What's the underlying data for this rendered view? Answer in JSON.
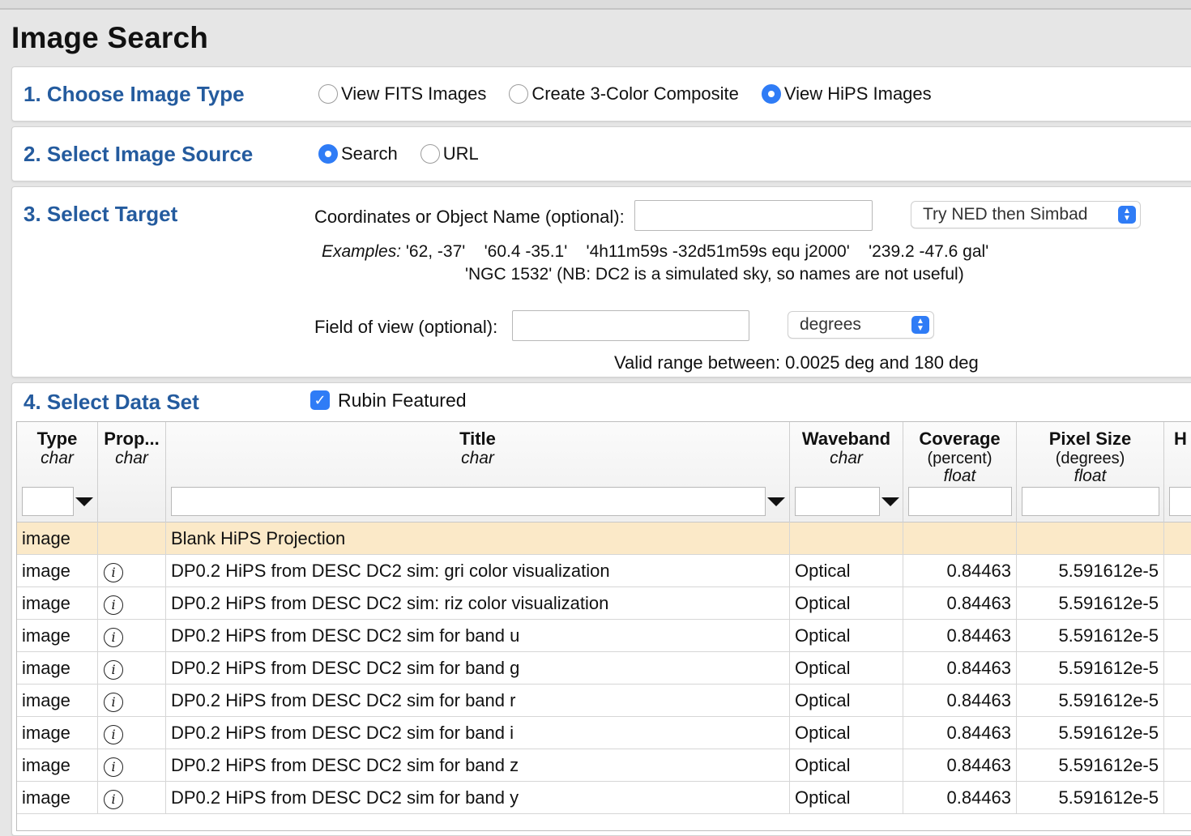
{
  "page": {
    "title": "Image Search"
  },
  "section1": {
    "title": "1. Choose Image Type",
    "options": [
      {
        "label": "View FITS Images",
        "selected": false
      },
      {
        "label": "Create 3-Color Composite",
        "selected": false
      },
      {
        "label": "View HiPS Images",
        "selected": true
      }
    ]
  },
  "section2": {
    "title": "2. Select Image Source",
    "options": [
      {
        "label": "Search",
        "selected": true
      },
      {
        "label": "URL",
        "selected": false
      }
    ]
  },
  "section3": {
    "title": "3. Select Target",
    "coords_label": "Coordinates or Object Name (optional):",
    "coords_value": "",
    "resolver_selected": "Try NED then Simbad",
    "examples_label": "Examples:",
    "examples_line1": "'62, -37'    '60.4 -35.1'    '4h11m59s -32d51m59s equ j2000'    '239.2 -47.6 gal'",
    "examples_line2": "'NGC 1532' (NB: DC2 is a simulated sky, so names are not useful)",
    "fov_label": "Field of view (optional):",
    "fov_value": "",
    "fov_unit_selected": "degrees",
    "valid_range": "Valid range between: 0.0025 deg and 180 deg"
  },
  "section4": {
    "title": "4. Select Data Set",
    "checkbox_label": "Rubin Featured",
    "checkbox_checked": true
  },
  "table": {
    "columns": [
      {
        "name": "Type",
        "unit": "",
        "type": "char"
      },
      {
        "name": "Prop...",
        "unit": "",
        "type": "char"
      },
      {
        "name": "Title",
        "unit": "",
        "type": "char"
      },
      {
        "name": "Waveband",
        "unit": "",
        "type": "char"
      },
      {
        "name": "Coverage",
        "unit": "(percent)",
        "type": "float"
      },
      {
        "name": "Pixel Size",
        "unit": "(degrees)",
        "type": "float"
      },
      {
        "name": "H",
        "unit": "",
        "type": ""
      }
    ],
    "rows": [
      {
        "type": "image",
        "info": false,
        "title": "Blank HiPS Projection",
        "waveband": "",
        "coverage": "",
        "pixel_size": "",
        "highlight": true
      },
      {
        "type": "image",
        "info": true,
        "title": "DP0.2 HiPS from DESC DC2 sim: gri color visualization",
        "waveband": "Optical",
        "coverage": "0.84463",
        "pixel_size": "5.591612e-5",
        "highlight": false
      },
      {
        "type": "image",
        "info": true,
        "title": "DP0.2 HiPS from DESC DC2 sim: riz color visualization",
        "waveband": "Optical",
        "coverage": "0.84463",
        "pixel_size": "5.591612e-5",
        "highlight": false
      },
      {
        "type": "image",
        "info": true,
        "title": "DP0.2 HiPS from DESC DC2 sim for band u",
        "waveband": "Optical",
        "coverage": "0.84463",
        "pixel_size": "5.591612e-5",
        "highlight": false
      },
      {
        "type": "image",
        "info": true,
        "title": "DP0.2 HiPS from DESC DC2 sim for band g",
        "waveband": "Optical",
        "coverage": "0.84463",
        "pixel_size": "5.591612e-5",
        "highlight": false
      },
      {
        "type": "image",
        "info": true,
        "title": "DP0.2 HiPS from DESC DC2 sim for band r",
        "waveband": "Optical",
        "coverage": "0.84463",
        "pixel_size": "5.591612e-5",
        "highlight": false
      },
      {
        "type": "image",
        "info": true,
        "title": "DP0.2 HiPS from DESC DC2 sim for band i",
        "waveband": "Optical",
        "coverage": "0.84463",
        "pixel_size": "5.591612e-5",
        "highlight": false
      },
      {
        "type": "image",
        "info": true,
        "title": "DP0.2 HiPS from DESC DC2 sim for band z",
        "waveband": "Optical",
        "coverage": "0.84463",
        "pixel_size": "5.591612e-5",
        "highlight": false
      },
      {
        "type": "image",
        "info": true,
        "title": "DP0.2 HiPS from DESC DC2 sim for band y",
        "waveband": "Optical",
        "coverage": "0.84463",
        "pixel_size": "5.591612e-5",
        "highlight": false
      }
    ]
  },
  "icons": {
    "info": "info-icon",
    "dropdown": "dropdown-arrow-icon",
    "select_arrows": "chevron-updown-icon",
    "check": "check-icon"
  },
  "colors": {
    "accent": "#2f7cf6",
    "section_title": "#245b9e",
    "highlight_row": "#fbe9c8"
  }
}
